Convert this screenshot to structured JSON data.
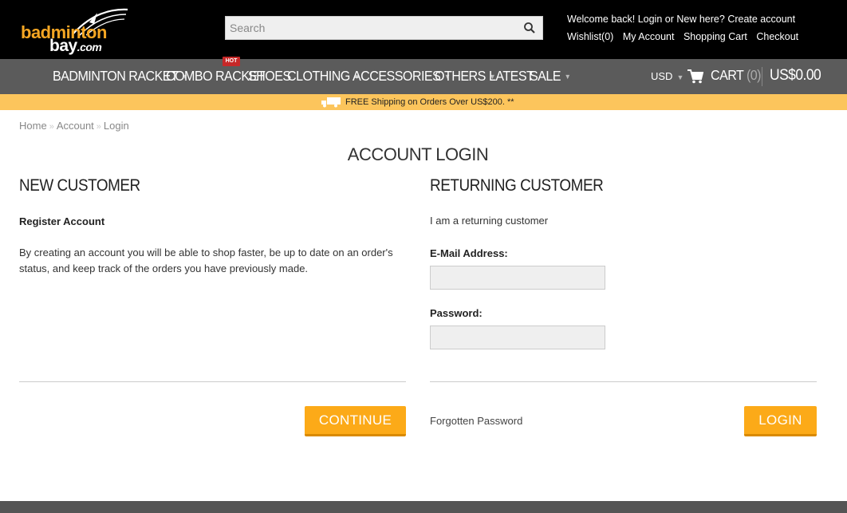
{
  "logo": {
    "line1": "badminton",
    "line2": "bay",
    "suffix": ".com"
  },
  "search": {
    "placeholder": "Search"
  },
  "welcome": {
    "prefix": "Welcome back!",
    "login": "Login",
    "middle": "or New here?",
    "create": "Create account"
  },
  "toplinks": [
    "Wishlist(0)",
    "My Account",
    "Shopping Cart",
    "Checkout"
  ],
  "nav": [
    {
      "label": "BADMINTON RACKET",
      "dropdown": true
    },
    {
      "label": "COMBO RACKET",
      "dropdown": false
    },
    {
      "label": "SHOES",
      "dropdown": false
    },
    {
      "label": "CLOTHING",
      "dropdown": true
    },
    {
      "label": "ACCESSORIES",
      "dropdown": true
    },
    {
      "label": "OTHERS",
      "dropdown": true
    },
    {
      "label": "LATEST",
      "dropdown": false
    },
    {
      "label": "SALE",
      "dropdown": true
    }
  ],
  "hot_badge": "HOT",
  "currency": "USD",
  "cart": {
    "label": "CART",
    "count": "(0)",
    "total": "US$0.00"
  },
  "promo": "FREE Shipping on Orders Over US$200. **",
  "breadcrumb": [
    "Home",
    "Account",
    "Login"
  ],
  "page_title": "ACCOUNT LOGIN",
  "new_customer": {
    "title": "NEW CUSTOMER",
    "subtitle": "Register Account",
    "text": "By creating an account you will be able to shop faster, be up to date on an order's status, and keep track of the orders you have previously made.",
    "button": "CONTINUE"
  },
  "returning_customer": {
    "title": "RETURNING CUSTOMER",
    "subtitle": "I am a returning customer",
    "email_label": "E-Mail Address:",
    "email_value": "",
    "password_label": "Password:",
    "password_value": "",
    "forgot": "Forgotten Password",
    "button": "LOGIN"
  },
  "colors": {
    "accent": "#fcaa18",
    "promo_bg": "#fcc55c",
    "nav_bg": "#5b5b5b",
    "top_bg": "#000000"
  }
}
